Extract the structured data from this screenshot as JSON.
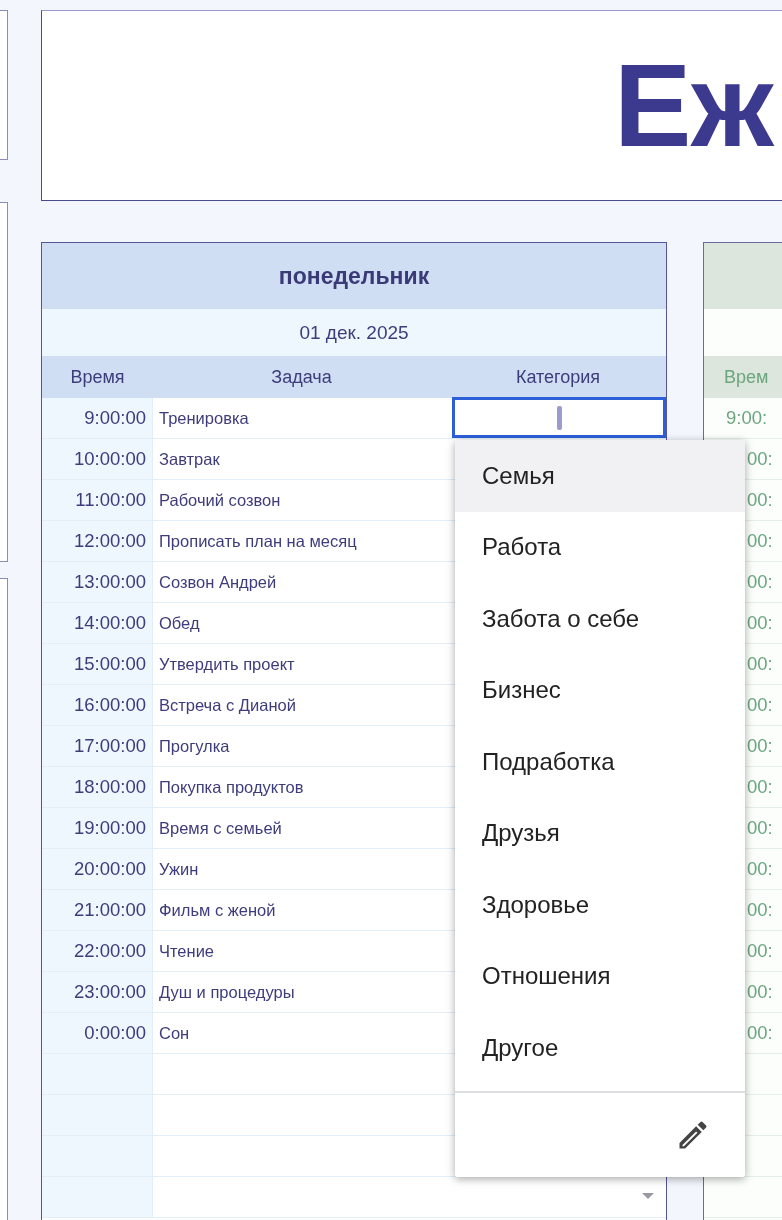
{
  "header": {
    "title": "Еж"
  },
  "monday": {
    "day": "понедельник",
    "date": "01 дек. 2025",
    "columns": [
      "Время",
      "Задача",
      "Категория"
    ],
    "rows": [
      {
        "time": "9:00:00",
        "task": "Тренировка",
        "selected": true
      },
      {
        "time": "10:00:00",
        "task": "Завтрак",
        "selected": false
      },
      {
        "time": "11:00:00",
        "task": "Рабочий созвон",
        "selected": false
      },
      {
        "time": "12:00:00",
        "task": "Прописать план на месяц",
        "selected": false
      },
      {
        "time": "13:00:00",
        "task": "Созвон Андрей",
        "selected": false
      },
      {
        "time": "14:00:00",
        "task": "Обед",
        "selected": false
      },
      {
        "time": "15:00:00",
        "task": "Утвердить проект",
        "selected": false
      },
      {
        "time": "16:00:00",
        "task": "Встреча с Дианой",
        "selected": false
      },
      {
        "time": "17:00:00",
        "task": "Прогулка",
        "selected": false
      },
      {
        "time": "18:00:00",
        "task": "Покупка продуктов",
        "selected": false
      },
      {
        "time": "19:00:00",
        "task": "Время с семьей",
        "selected": false
      },
      {
        "time": "20:00:00",
        "task": "Ужин",
        "selected": false
      },
      {
        "time": "21:00:00",
        "task": "Фильм с женой",
        "selected": false
      },
      {
        "time": "22:00:00",
        "task": "Чтение",
        "selected": false
      },
      {
        "time": "23:00:00",
        "task": "Душ и процедуры",
        "selected": false
      },
      {
        "time": "0:00:00",
        "task": "Сон",
        "selected": false
      },
      {
        "selected": false
      },
      {
        "selected": false
      },
      {
        "selected": false
      },
      {
        "selected": false
      }
    ]
  },
  "tuesday": {
    "column_header": "Врем",
    "times": [
      "9:00:",
      "00:",
      "00:",
      "00:",
      "00:",
      "00:",
      "00:",
      "00:",
      "00:",
      "00:",
      "00:",
      "00:",
      "00:",
      "00:",
      "00:",
      "00:"
    ]
  },
  "category_menu": {
    "options": [
      {
        "label": "Семья",
        "selected": true
      },
      {
        "label": "Работа",
        "selected": false
      },
      {
        "label": "Забота о себе",
        "selected": false
      },
      {
        "label": "Бизнес",
        "selected": false
      },
      {
        "label": "Подработка",
        "selected": false
      },
      {
        "label": "Друзья",
        "selected": false
      },
      {
        "label": "Здоровье",
        "selected": false
      },
      {
        "label": "Отношения",
        "selected": false
      },
      {
        "label": "Другое",
        "selected": false
      }
    ]
  }
}
